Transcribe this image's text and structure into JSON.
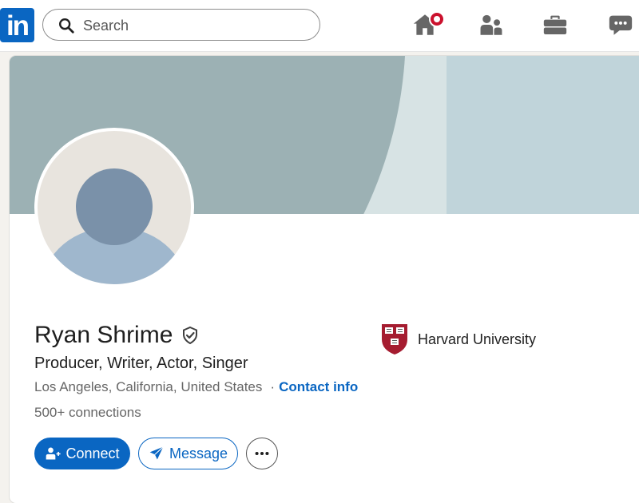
{
  "nav": {
    "logo_text": "in",
    "search_placeholder": "Search",
    "icons": [
      "home-icon",
      "my-network-icon",
      "jobs-icon",
      "messaging-icon"
    ]
  },
  "profile": {
    "name": "Ryan Shrime",
    "headline": "Producer, Writer, Actor, Singer",
    "location": "Los Angeles, California, United States",
    "separator": "·",
    "contact_info": "Contact info",
    "connections": "500+ connections",
    "education": "Harvard University"
  },
  "actions": {
    "connect_label": "Connect",
    "message_label": "Message",
    "more_label": "…"
  },
  "colors": {
    "brand": "#0a66c2",
    "notification": "#cb112d",
    "banner_dark": "#9cb1b4",
    "banner_light": "#d7e3e4",
    "banner_right": "#c0d4da"
  }
}
